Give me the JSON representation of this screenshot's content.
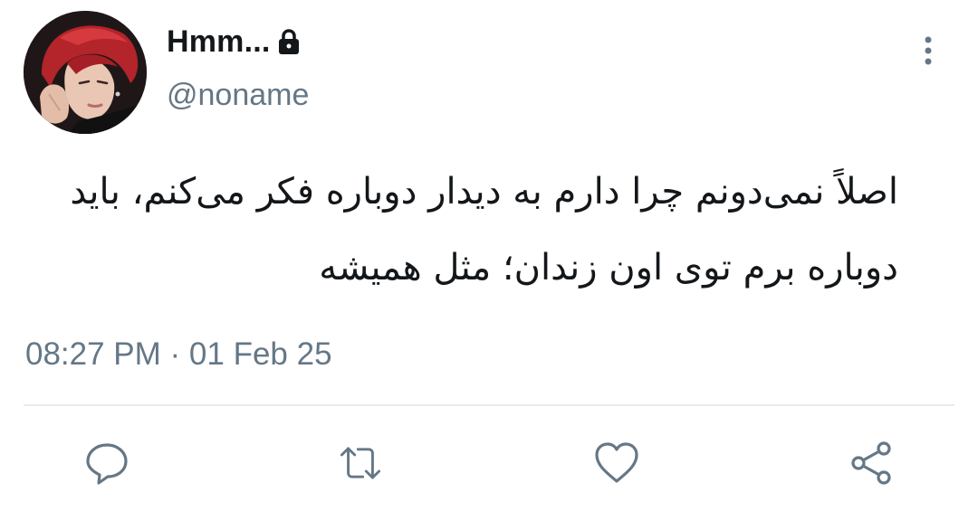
{
  "author": {
    "display_name": "Hmm...",
    "handle": "@noname",
    "protected_icon": "lock-icon",
    "avatar_icon": "profile-photo"
  },
  "tweet": {
    "text_line_1": "اصلاً نمی‌دونم چرا دارم به دیدار دوباره فکر می‌کنم، باید",
    "text_line_2": "دوباره برم توی اون زندان؛ مثل همیشه",
    "time": "08:27 PM",
    "separator": " · ",
    "date": "01 Feb 25"
  },
  "menu_icon": "more-vertical-icon",
  "actions": [
    {
      "icon": "reply-icon"
    },
    {
      "icon": "retweet-icon"
    },
    {
      "icon": "like-icon"
    },
    {
      "icon": "share-icon"
    }
  ],
  "colors": {
    "text_primary": "#14171a",
    "text_secondary": "#657786",
    "divider": "#e6ecf0",
    "icon": "#657786"
  }
}
